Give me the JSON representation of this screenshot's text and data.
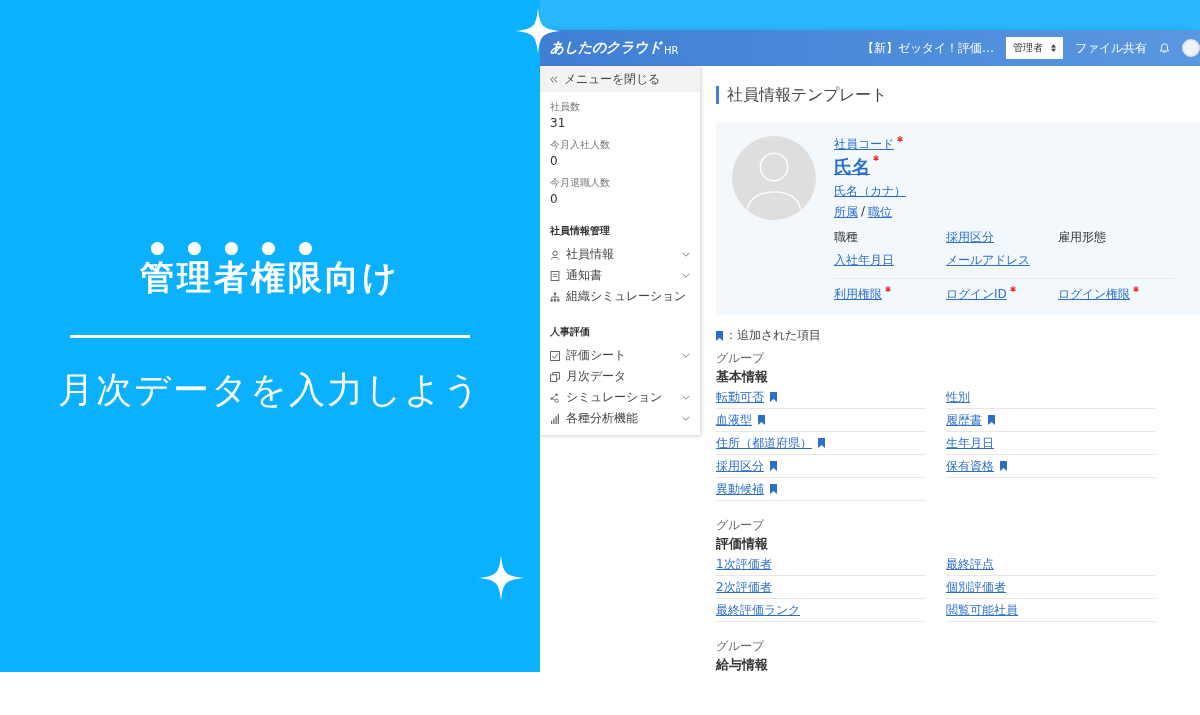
{
  "hero": {
    "title_emphasized": "管理者権限",
    "title_rest": "向け",
    "subtitle": "月次データを入力しよう"
  },
  "app": {
    "header": {
      "logo": "あしたのクラウド",
      "logo_suffix": "HR",
      "notice": "【新】ゼッタイ！評価…",
      "role_select": "管理者",
      "file_share": "ファイル共有"
    },
    "sidebar": {
      "close_menu": "メニューを閉じる",
      "stats": [
        {
          "label": "社員数",
          "value": "31"
        },
        {
          "label": "今月入社人数",
          "value": "0"
        },
        {
          "label": "今月退職人数",
          "value": "0"
        }
      ],
      "sections": [
        {
          "title": "社員情報管理",
          "items": [
            {
              "label": "社員情報",
              "expandable": true
            },
            {
              "label": "通知書",
              "expandable": true
            },
            {
              "label": "組織シミュレーション",
              "expandable": false
            }
          ]
        },
        {
          "title": "人事評価",
          "items": [
            {
              "label": "評価シート",
              "expandable": true
            },
            {
              "label": "月次データ",
              "expandable": false
            },
            {
              "label": "シミュレーション",
              "expandable": true
            },
            {
              "label": "各種分析機能",
              "expandable": true
            }
          ]
        }
      ]
    },
    "main": {
      "title": "社員情報テンプレート",
      "profile": {
        "employee_code": "社員コード",
        "employee_code_required": true,
        "name": "氏名",
        "name_required": true,
        "name_kana": "氏名（カナ）",
        "affiliation": "所属",
        "separator": "/",
        "position": "職位",
        "fields": [
          {
            "label": "職種",
            "link": false,
            "required": false
          },
          {
            "label": "採用区分",
            "link": true,
            "required": false
          },
          {
            "label": "雇用形態",
            "link": false,
            "required": false
          },
          {
            "label": "入社年月日",
            "link": true,
            "required": false
          },
          {
            "label": "メールアドレス",
            "link": true,
            "required": false
          }
        ],
        "account_fields": [
          {
            "label": "利用権限",
            "link": true,
            "required": true
          },
          {
            "label": "ログインID",
            "link": true,
            "required": true
          },
          {
            "label": "ログイン権限",
            "link": true,
            "required": true
          }
        ]
      },
      "legend": "：追加された項目",
      "groups": [
        {
          "caption": "グループ",
          "title": "基本情報",
          "fields": [
            {
              "label": "転勤可否",
              "added": true
            },
            {
              "label": "性別",
              "added": false
            },
            {
              "label": "血液型",
              "added": true
            },
            {
              "label": "履歴書",
              "added": true
            },
            {
              "label": "住所（都道府県）",
              "added": true
            },
            {
              "label": "生年月日",
              "added": false
            },
            {
              "label": "採用区分",
              "added": true
            },
            {
              "label": "保有資格",
              "added": true
            },
            {
              "label": "異動候補",
              "added": true
            }
          ]
        },
        {
          "caption": "グループ",
          "title": "評価情報",
          "fields": [
            {
              "label": "1次評価者",
              "added": false
            },
            {
              "label": "最終評点",
              "added": false
            },
            {
              "label": "2次評価者",
              "added": false
            },
            {
              "label": "個別評価者",
              "added": false
            },
            {
              "label": "最終評価ランク",
              "added": false
            },
            {
              "label": "閲覧可能社員",
              "added": false
            }
          ]
        },
        {
          "caption": "グループ",
          "title": "給与情報"
        }
      ]
    }
  }
}
